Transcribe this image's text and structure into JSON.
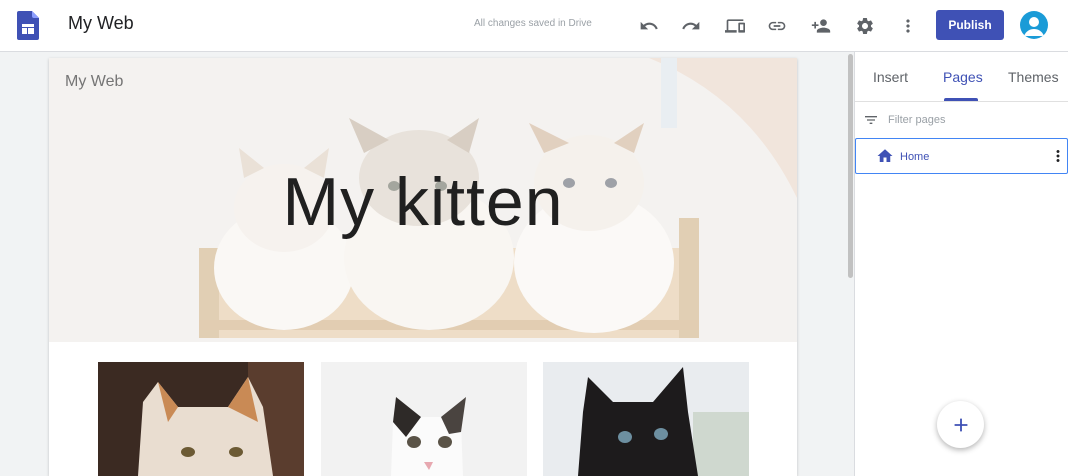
{
  "app": {
    "title": "My Web",
    "save_status": "All changes saved in Drive"
  },
  "toolbar": {
    "buttons": [
      {
        "name": "undo-icon"
      },
      {
        "name": "redo-icon"
      },
      {
        "name": "preview-icon"
      },
      {
        "name": "link-icon"
      },
      {
        "name": "share-icon"
      },
      {
        "name": "gear-icon"
      },
      {
        "name": "more-vert-icon"
      }
    ],
    "publish_label": "Publish"
  },
  "site": {
    "name": "My Web",
    "hero_title": "My kitten",
    "photos": [
      "kitten-ginger-white",
      "kitten-tabby-white",
      "kitten-black"
    ]
  },
  "panel": {
    "tabs": [
      {
        "label": "Insert",
        "active": false
      },
      {
        "label": "Pages",
        "active": true
      },
      {
        "label": "Themes",
        "active": false
      }
    ],
    "filter_placeholder": "Filter pages",
    "pages": [
      {
        "label": "Home",
        "icon": "home-icon"
      }
    ]
  },
  "colors": {
    "accent": "#3f51b5",
    "avatar": "#1a9bd7"
  }
}
